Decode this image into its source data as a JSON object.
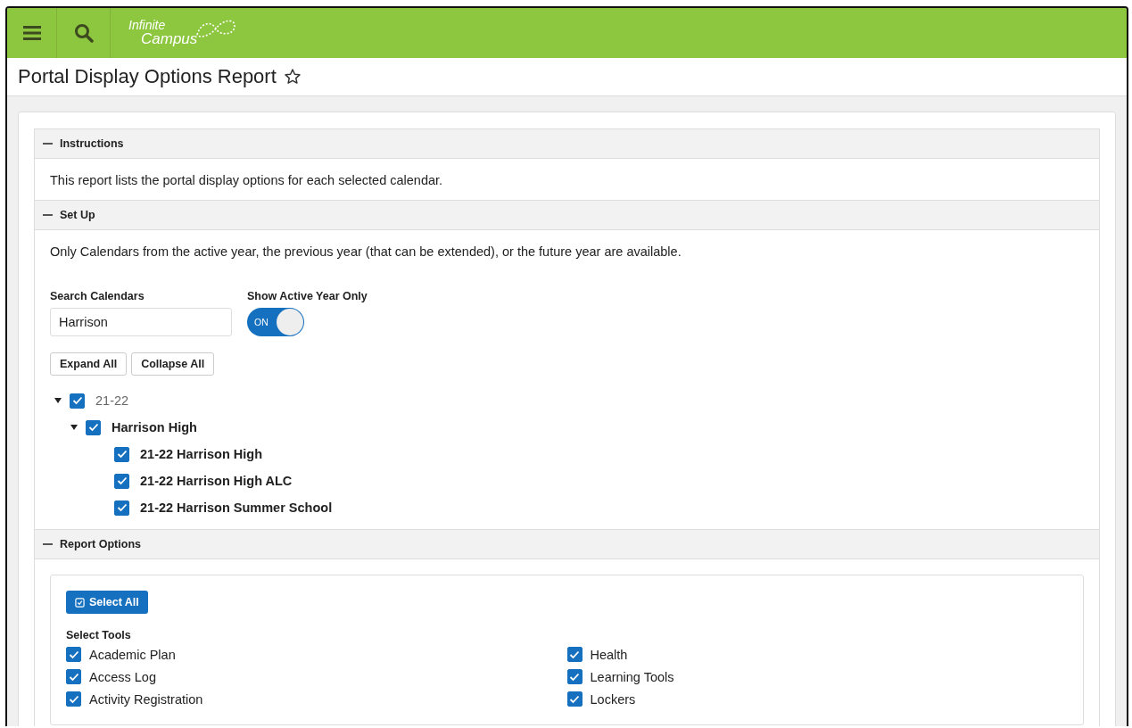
{
  "header": {
    "logo": {
      "line1": "Infinite",
      "line2": "Campus"
    }
  },
  "page_title": {
    "text": "Portal Display Options Report",
    "favorite": false
  },
  "sections": [
    {
      "kind": "text",
      "title": "Instructions",
      "expanded": true,
      "text": "This report lists the portal display options for each selected calendar."
    },
    {
      "kind": "setup",
      "title": "Set Up",
      "expanded": true,
      "text": "Only Calendars from the active year, the previous year (that can be extended), or the future year are available.",
      "search": {
        "label": "Search Calendars",
        "value": "Harrison"
      },
      "toggle": {
        "label": "Show Active Year Only",
        "on": true,
        "text": "ON"
      },
      "buttons": [
        "Expand All",
        "Collapse All"
      ],
      "tree": [
        {
          "label": "21-22",
          "checked": true,
          "expanded": true,
          "bold": false,
          "children": [
            {
              "label": "Harrison High",
              "checked": true,
              "expanded": true,
              "bold": true,
              "children": [
                {
                  "label": "21-22 Harrison High",
                  "checked": true,
                  "bold": true
                },
                {
                  "label": "21-22 Harrison High ALC",
                  "checked": true,
                  "bold": true
                },
                {
                  "label": "21-22 Harrison Summer School",
                  "checked": true,
                  "bold": true
                }
              ]
            }
          ]
        }
      ]
    },
    {
      "kind": "options",
      "title": "Report Options",
      "expanded": true,
      "select_all": "Select All",
      "tools_label": "Select Tools",
      "tools": [
        [
          {
            "label": "Academic Plan",
            "checked": true
          },
          {
            "label": "Access Log",
            "checked": true
          },
          {
            "label": "Activity Registration",
            "checked": true
          }
        ],
        [
          {
            "label": "Health",
            "checked": true
          },
          {
            "label": "Learning Tools",
            "checked": true
          },
          {
            "label": "Lockers",
            "checked": true
          }
        ]
      ]
    }
  ]
}
